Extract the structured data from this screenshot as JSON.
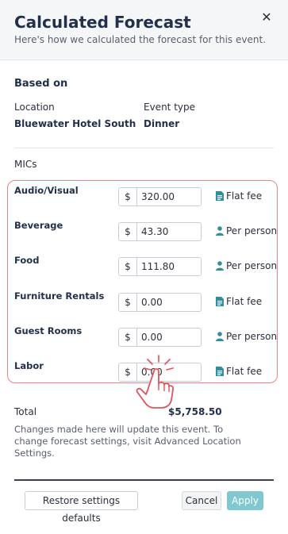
{
  "header": {
    "title": "Calculated Forecast",
    "subtitle": "Here's how we calculated the forecast for this event."
  },
  "based_on": {
    "heading": "Based on",
    "location_label": "Location",
    "location_value": "Bluewater Hotel South",
    "event_type_label": "Event type",
    "event_type_value": "Dinner"
  },
  "mics": {
    "heading": "MICs",
    "currency_symbol": "$",
    "rows": [
      {
        "label": "Audio/Visual",
        "amount": "320.00",
        "fee_type": "Flat fee",
        "icon": "document-icon"
      },
      {
        "label": "Beverage",
        "amount": "43.30",
        "fee_type": "Per person",
        "icon": "person-icon"
      },
      {
        "label": "Food",
        "amount": "111.80",
        "fee_type": "Per person",
        "icon": "person-icon"
      },
      {
        "label": "Furniture Rentals",
        "amount": "0.00",
        "fee_type": "Flat fee",
        "icon": "document-icon"
      },
      {
        "label": "Guest Rooms",
        "amount": "0.00",
        "fee_type": "Per person",
        "icon": "person-icon"
      },
      {
        "label": "Labor",
        "amount": "0.00",
        "fee_type": "Flat fee",
        "icon": "document-icon"
      }
    ]
  },
  "total": {
    "label": "Total",
    "value": "$5,758.50"
  },
  "note": "Changes made here will update this event. To change forecast settings, visit Advanced Location Settings.",
  "footer": {
    "restore_label": "Restore settings defaults",
    "cancel_label": "Cancel",
    "apply_label": "Apply"
  },
  "colors": {
    "accent": "#3aa6b0",
    "apply_button": "#7fc8cf",
    "highlight_border": "#e8848c",
    "title": "#22304a"
  }
}
